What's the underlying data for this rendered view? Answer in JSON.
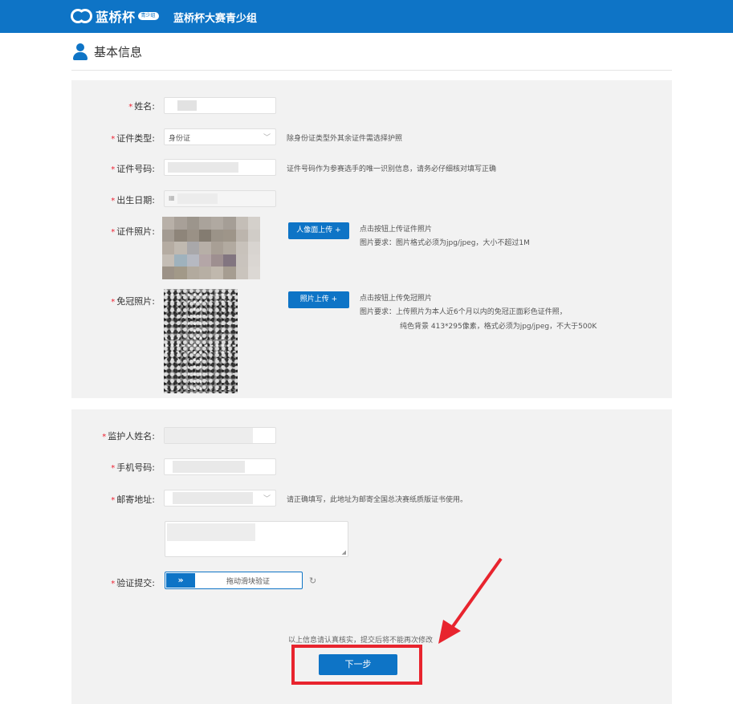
{
  "header": {
    "logo_text": "蓝桥杯",
    "logo_badge": "青少组",
    "title": "蓝桥杯大赛青少组"
  },
  "section": {
    "title": "基本信息",
    "icon": "user-icon"
  },
  "form1": {
    "name_label": "姓名:",
    "id_type_label": "证件类型:",
    "id_type_value": "身份证",
    "id_type_hint": "除身份证类型外其余证件需选择护照",
    "id_number_label": "证件号码:",
    "id_number_hint": "证件号码作为参赛选手的唯一识别信息，请务必仔细核对填写正确",
    "birth_label": "出生日期:",
    "id_photo_label": "证件照片:",
    "id_photo_button": "人像面上传 +",
    "id_photo_hint1": "点击按钮上传证件照片",
    "id_photo_hint2": "图片要求：图片格式必须为jpg/jpeg，大小不超过1M",
    "hat_photo_label": "免冠照片:",
    "hat_photo_button": "照片上传 +",
    "hat_photo_hint1": "点击按钮上传免冠照片",
    "hat_photo_hint2": "图片要求：上传照片为本人近6个月以内的免冠正面彩色证件照，",
    "hat_photo_hint3": "纯色背景 413*295像素，格式必须为jpg/jpeg，不大于500K"
  },
  "form2": {
    "guardian_label": "监护人姓名:",
    "phone_label": "手机号码:",
    "address_label": "邮寄地址:",
    "address_hint": "请正确填写，此地址为邮寄全国总决赛纸质版证书使用。",
    "verify_label": "验证提交:",
    "slider_text": "拖动滑块验证",
    "slider_handle": "»",
    "notice": "以上信息请认真核实，提交后将不能再次修改",
    "next_button": "下一步"
  },
  "colors": {
    "brand": "#0e74c6",
    "required": "#e23333",
    "highlight": "#e8242e"
  }
}
